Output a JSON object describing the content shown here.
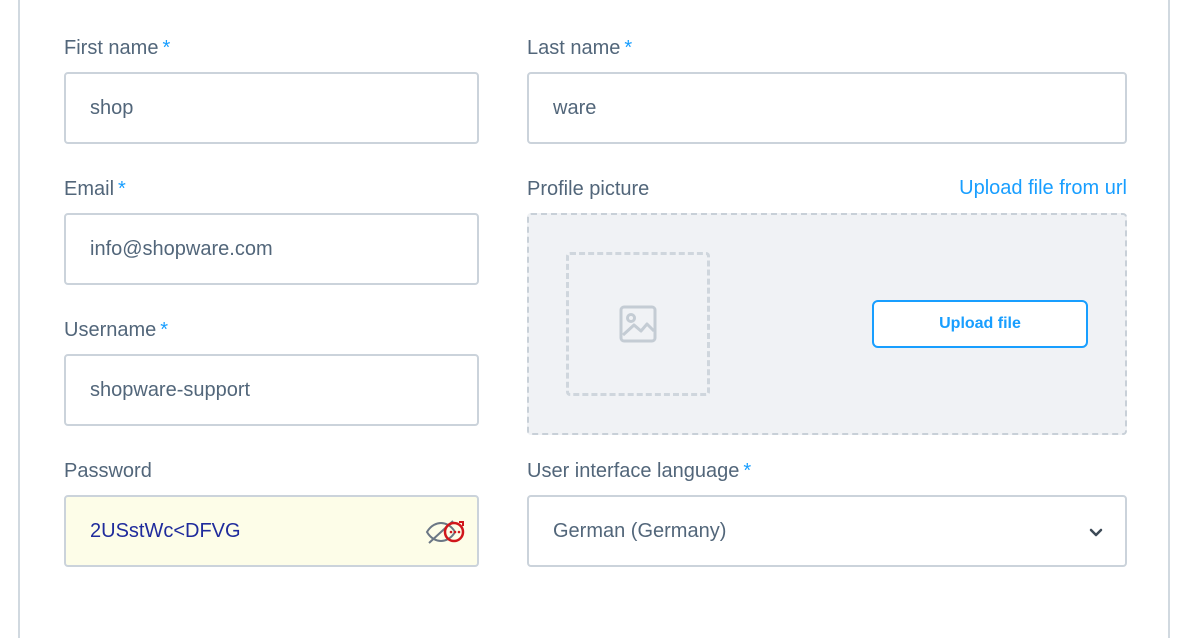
{
  "form": {
    "first_name": {
      "label": "First name",
      "required": "*",
      "value": "shop"
    },
    "last_name": {
      "label": "Last name",
      "required": "*",
      "value": "ware"
    },
    "email": {
      "label": "Email",
      "required": "*",
      "value": "info@shopware.com"
    },
    "profile_picture": {
      "label": "Profile picture",
      "upload_url_link": "Upload file from url",
      "upload_button": "Upload file",
      "placeholder_icon": "image-icon"
    },
    "username": {
      "label": "Username",
      "required": "*",
      "value": "shopware-support"
    },
    "password": {
      "label": "Password",
      "value": "2USstWc<DFVG",
      "toggle_icon": "eye-slash-icon",
      "manager_icon": "password-manager-icon"
    },
    "language": {
      "label": "User interface language",
      "required": "*",
      "value": "German (Germany)",
      "dropdown_icon": "chevron-down-icon"
    }
  },
  "colors": {
    "accent": "#189eff",
    "label": "#52667a",
    "border": "#cbd3db",
    "autofill_bg": "#fdfde8"
  }
}
